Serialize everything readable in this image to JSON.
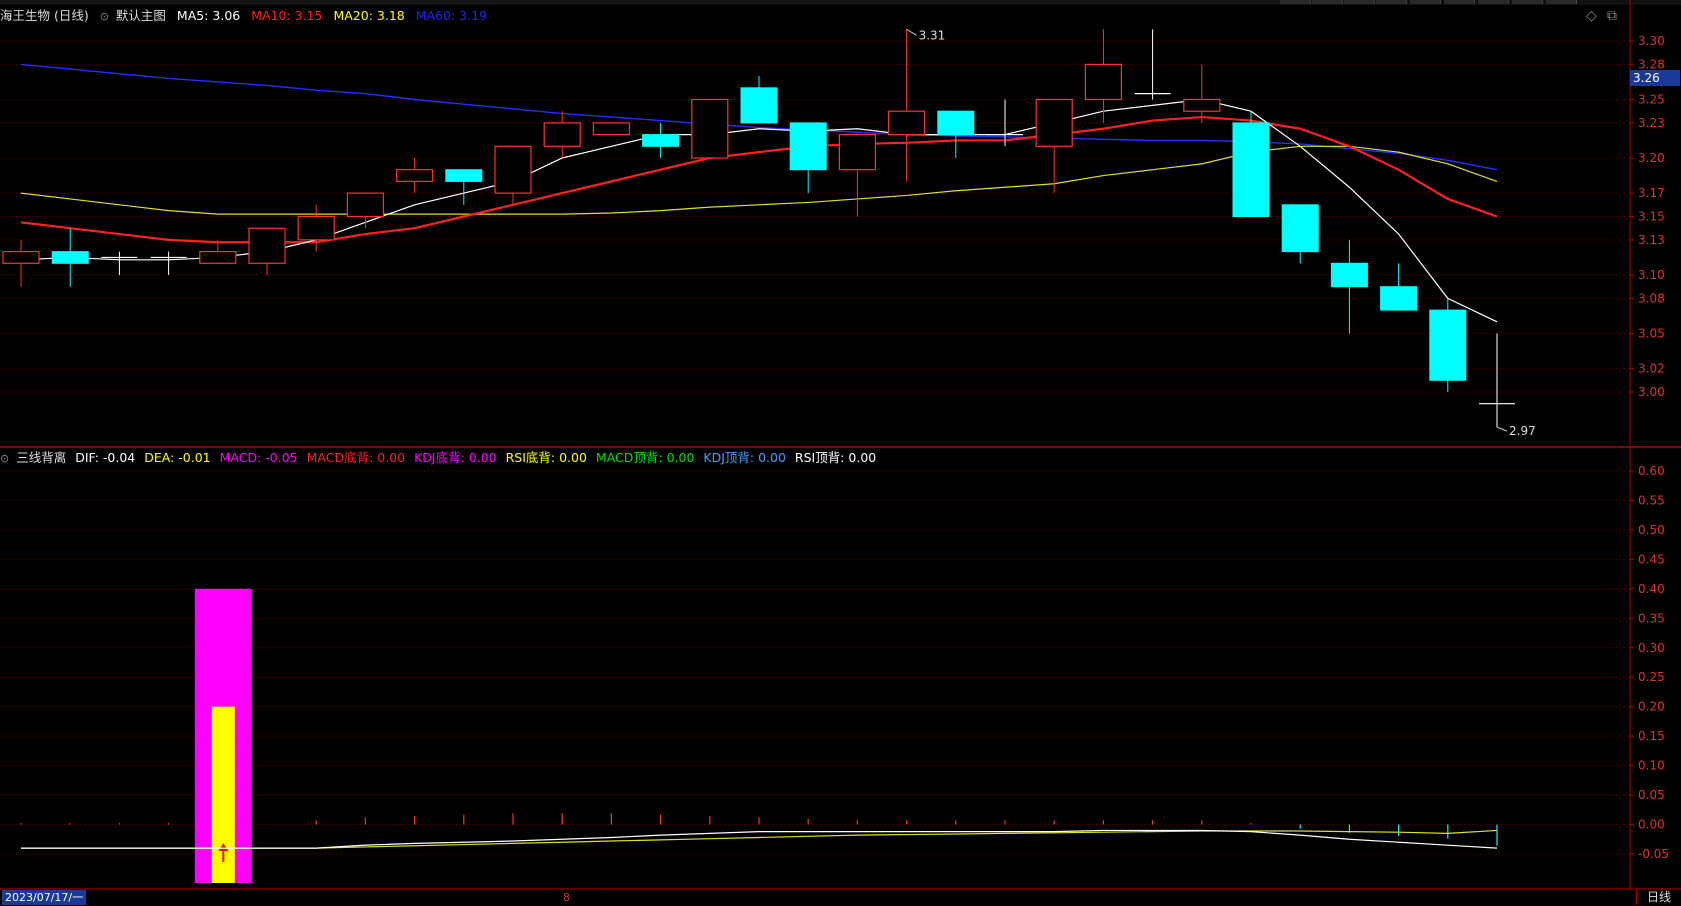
{
  "header": {
    "stock": "海王生物 (日线)",
    "template": "默认主图",
    "ma": [
      {
        "label": "MA5: 3.06",
        "color": "#ffffff"
      },
      {
        "label": "MA10: 3.15",
        "color": "#ff2020"
      },
      {
        "label": "MA20: 3.18",
        "color": "#ffff00"
      },
      {
        "label": "MA60: 3.19",
        "color": "#2020ff"
      }
    ]
  },
  "sub_header": {
    "name": "三线背离",
    "items": [
      {
        "label": "DIF: -0.04",
        "color": "#ffffff"
      },
      {
        "label": "DEA: -0.01",
        "color": "#ffff00"
      },
      {
        "label": "MACD: -0.05",
        "color": "#ff00ff"
      },
      {
        "label": "MACD底背: 0.00",
        "color": "#ff2020"
      },
      {
        "label": "KDJ底背: 0.00",
        "color": "#ff00ff"
      },
      {
        "label": "RSI底背: 0.00",
        "color": "#ffff00"
      },
      {
        "label": "MACD顶背: 0.00",
        "color": "#00e000"
      },
      {
        "label": "KDJ顶背: 0.00",
        "color": "#40a0ff"
      },
      {
        "label": "RSI顶背: 0.00",
        "color": "#ffffff"
      }
    ]
  },
  "icons": {
    "settings": "diamond-icon",
    "window": "restore-icon",
    "collapse": "collapse-icon"
  },
  "colors": {
    "up": "#ff3030",
    "down": "#00ffff",
    "grid": "#5a0000",
    "axis": "#b00000"
  },
  "price_axis": {
    "ticks": [
      "3.30",
      "3.28",
      "3.25",
      "3.23",
      "3.20",
      "3.17",
      "3.15",
      "3.13",
      "3.10",
      "3.08",
      "3.05",
      "3.02",
      "3.00"
    ],
    "current_price": "3.26"
  },
  "annotations": {
    "high": "3.31",
    "low": "2.97"
  },
  "indicator_axis": {
    "ticks": [
      "0.60",
      "0.55",
      "0.50",
      "0.45",
      "0.40",
      "0.35",
      "0.30",
      "0.25",
      "0.20",
      "0.15",
      "0.10",
      "0.05",
      "0.00",
      "-0.05"
    ]
  },
  "chart_data": {
    "type": "candlestick",
    "candles": [
      {
        "o": 3.11,
        "c": 3.12,
        "h": 3.13,
        "l": 3.09
      },
      {
        "o": 3.12,
        "c": 3.11,
        "h": 3.14,
        "l": 3.09
      },
      {
        "o": 3.115,
        "c": 3.115,
        "h": 3.12,
        "l": 3.1
      },
      {
        "o": 3.115,
        "c": 3.115,
        "h": 3.12,
        "l": 3.1
      },
      {
        "o": 3.11,
        "c": 3.12,
        "h": 3.13,
        "l": 3.11
      },
      {
        "o": 3.11,
        "c": 3.14,
        "h": 3.14,
        "l": 3.1
      },
      {
        "o": 3.13,
        "c": 3.15,
        "h": 3.16,
        "l": 3.12
      },
      {
        "o": 3.15,
        "c": 3.17,
        "h": 3.17,
        "l": 3.14
      },
      {
        "o": 3.18,
        "c": 3.19,
        "h": 3.2,
        "l": 3.17
      },
      {
        "o": 3.19,
        "c": 3.18,
        "h": 3.19,
        "l": 3.16
      },
      {
        "o": 3.17,
        "c": 3.21,
        "h": 3.21,
        "l": 3.16
      },
      {
        "o": 3.21,
        "c": 3.23,
        "h": 3.24,
        "l": 3.2
      },
      {
        "o": 3.22,
        "c": 3.23,
        "h": 3.23,
        "l": 3.22
      },
      {
        "o": 3.22,
        "c": 3.21,
        "h": 3.23,
        "l": 3.2
      },
      {
        "o": 3.2,
        "c": 3.25,
        "h": 3.25,
        "l": 3.2
      },
      {
        "o": 3.26,
        "c": 3.23,
        "h": 3.27,
        "l": 3.23
      },
      {
        "o": 3.23,
        "c": 3.19,
        "h": 3.23,
        "l": 3.17
      },
      {
        "o": 3.19,
        "c": 3.22,
        "h": 3.22,
        "l": 3.15
      },
      {
        "o": 3.22,
        "c": 3.24,
        "h": 3.31,
        "l": 3.18
      },
      {
        "o": 3.24,
        "c": 3.22,
        "h": 3.24,
        "l": 3.2
      },
      {
        "o": 3.22,
        "c": 3.22,
        "h": 3.25,
        "l": 3.21
      },
      {
        "o": 3.21,
        "c": 3.25,
        "h": 3.25,
        "l": 3.17
      },
      {
        "o": 3.25,
        "c": 3.28,
        "h": 3.31,
        "l": 3.23
      },
      {
        "o": 3.255,
        "c": 3.255,
        "h": 3.31,
        "l": 3.25
      },
      {
        "o": 3.24,
        "c": 3.25,
        "h": 3.28,
        "l": 3.23
      },
      {
        "o": 3.23,
        "c": 3.15,
        "h": 3.24,
        "l": 3.15
      },
      {
        "o": 3.16,
        "c": 3.12,
        "h": 3.16,
        "l": 3.11
      },
      {
        "o": 3.11,
        "c": 3.09,
        "h": 3.13,
        "l": 3.05
      },
      {
        "o": 3.09,
        "c": 3.07,
        "h": 3.11,
        "l": 3.07
      },
      {
        "o": 3.07,
        "c": 3.01,
        "h": 3.08,
        "l": 3.0
      },
      {
        "o": 2.99,
        "c": 2.99,
        "h": 3.05,
        "l": 2.97
      }
    ],
    "ma5": [
      3.113,
      3.115,
      3.113,
      3.113,
      3.115,
      3.12,
      3.13,
      3.145,
      3.16,
      3.17,
      3.18,
      3.2,
      3.21,
      3.22,
      3.22,
      3.225,
      3.223,
      3.225,
      3.22,
      3.22,
      3.22,
      3.23,
      3.24,
      3.245,
      3.25,
      3.24,
      3.21,
      3.175,
      3.135,
      3.08,
      3.06
    ],
    "ma10": [
      3.145,
      3.14,
      3.135,
      3.13,
      3.128,
      3.128,
      3.128,
      3.135,
      3.14,
      3.15,
      3.16,
      3.17,
      3.18,
      3.19,
      3.2,
      3.205,
      3.21,
      3.212,
      3.213,
      3.215,
      3.215,
      3.22,
      3.225,
      3.232,
      3.235,
      3.232,
      3.225,
      3.21,
      3.19,
      3.165,
      3.15
    ],
    "ma20": [
      3.17,
      3.165,
      3.16,
      3.155,
      3.152,
      3.152,
      3.152,
      3.152,
      3.152,
      3.152,
      3.152,
      3.152,
      3.153,
      3.155,
      3.158,
      3.16,
      3.162,
      3.165,
      3.168,
      3.172,
      3.175,
      3.178,
      3.185,
      3.19,
      3.195,
      3.205,
      3.21,
      3.21,
      3.205,
      3.195,
      3.18
    ],
    "ma60": [
      3.28,
      3.276,
      3.272,
      3.268,
      3.265,
      3.262,
      3.258,
      3.255,
      3.25,
      3.246,
      3.242,
      3.238,
      3.235,
      3.232,
      3.229,
      3.226,
      3.224,
      3.222,
      3.22,
      3.219,
      3.218,
      3.217,
      3.216,
      3.215,
      3.215,
      3.214,
      3.212,
      3.208,
      3.204,
      3.198,
      3.19
    ],
    "dif": [
      -0.04,
      -0.04,
      -0.04,
      -0.04,
      -0.04,
      -0.04,
      -0.04,
      -0.035,
      -0.032,
      -0.03,
      -0.028,
      -0.025,
      -0.022,
      -0.018,
      -0.015,
      -0.012,
      -0.012,
      -0.012,
      -0.012,
      -0.012,
      -0.012,
      -0.012,
      -0.01,
      -0.01,
      -0.01,
      -0.012,
      -0.018,
      -0.025,
      -0.03,
      -0.035,
      -0.04
    ],
    "dea": [
      -0.04,
      -0.04,
      -0.04,
      -0.04,
      -0.04,
      -0.04,
      -0.04,
      -0.038,
      -0.036,
      -0.034,
      -0.032,
      -0.03,
      -0.028,
      -0.026,
      -0.024,
      -0.022,
      -0.02,
      -0.018,
      -0.017,
      -0.016,
      -0.015,
      -0.014,
      -0.013,
      -0.012,
      -0.011,
      -0.011,
      -0.011,
      -0.012,
      -0.013,
      -0.015,
      -0.01
    ],
    "macd": [
      0.002,
      0.002,
      0.002,
      0.002,
      0,
      0,
      0.006,
      0.01,
      0.012,
      0.014,
      0.016,
      0.016,
      0.016,
      0.014,
      0.012,
      0.01,
      0.008,
      0.006,
      0.006,
      0.006,
      0.006,
      0.006,
      0.006,
      0.006,
      0.006,
      0.002,
      -0.006,
      -0.012,
      -0.016,
      -0.02,
      -0.03
    ],
    "signal_bars": [
      {
        "index": 4,
        "magenta": 0.4,
        "yellow": 0.2
      }
    ],
    "price_range": [
      2.97,
      3.31
    ],
    "indicator_range": [
      -0.1,
      0.65
    ]
  },
  "footer": {
    "date": "2023/07/17/一",
    "marker": "8",
    "period": "日线"
  }
}
